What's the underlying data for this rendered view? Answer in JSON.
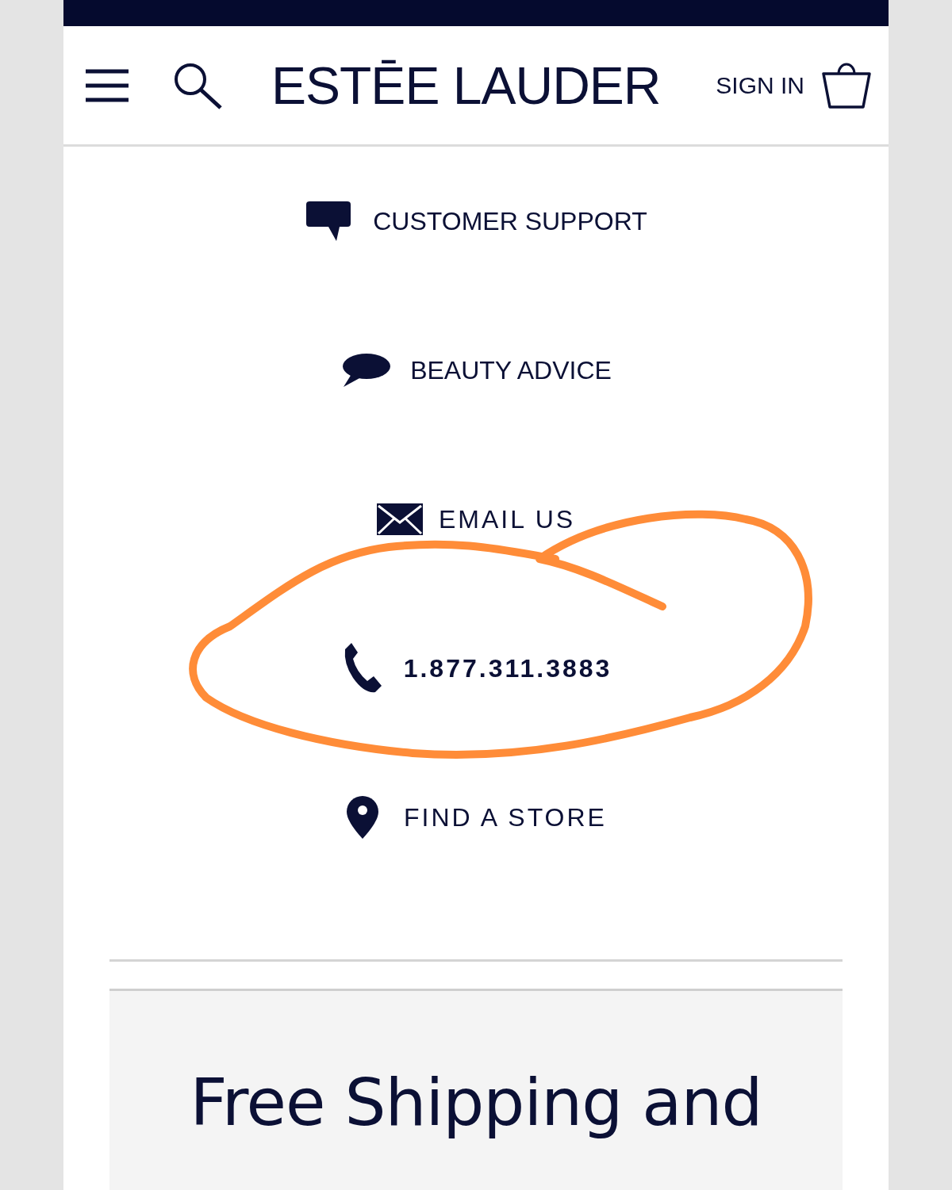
{
  "header": {
    "logo": "ESTĒE LAUDER",
    "sign_in": "SIGN IN"
  },
  "contact_links": [
    {
      "kind": "support",
      "label": "CUSTOMER SUPPORT"
    },
    {
      "kind": "advice",
      "label": "BEAUTY ADVICE"
    },
    {
      "kind": "email",
      "label": "EMAIL US"
    },
    {
      "kind": "phone",
      "label": "1.877.311.3883"
    },
    {
      "kind": "store",
      "label": "FIND A STORE"
    }
  ],
  "promo": {
    "heading": "Free Shipping and"
  }
}
